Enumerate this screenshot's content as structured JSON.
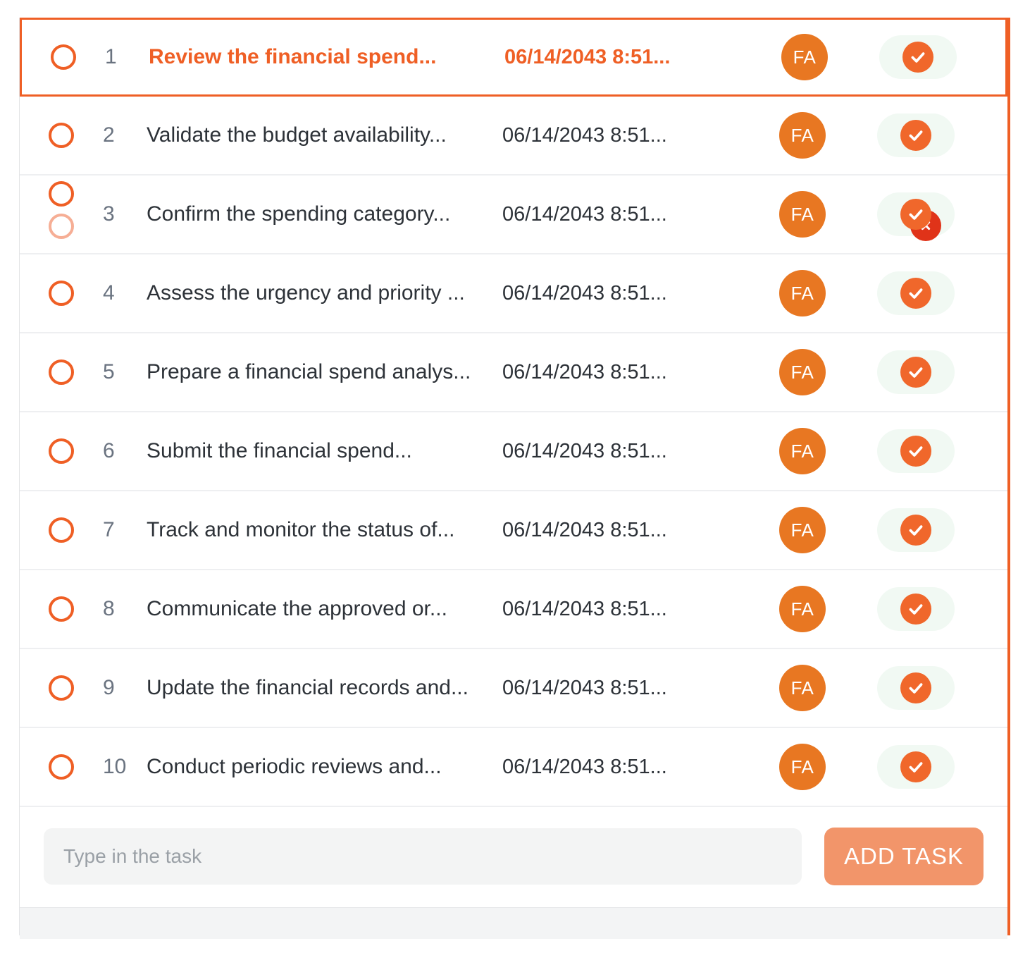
{
  "panel": {
    "accent_color": "#ef5f25",
    "selected_row_index": 1
  },
  "tasks": [
    {
      "index": "1",
      "title": "Review the financial spend...",
      "date": "06/14/2043 8:51...",
      "assignee_initials": "FA",
      "status": "done",
      "selected": true,
      "dragging": false
    },
    {
      "index": "2",
      "title": "Validate the budget availability...",
      "date": "06/14/2043 8:51...",
      "assignee_initials": "FA",
      "status": "done",
      "selected": false,
      "dragging": false
    },
    {
      "index": "3",
      "title": "Confirm the spending category...",
      "date": "06/14/2043 8:51...",
      "assignee_initials": "FA",
      "status": "done-rejected",
      "selected": false,
      "dragging": true
    },
    {
      "index": "4",
      "title": "Assess the urgency and priority ...",
      "date": "06/14/2043 8:51...",
      "assignee_initials": "FA",
      "status": "done",
      "selected": false,
      "dragging": false
    },
    {
      "index": "5",
      "title": "Prepare a financial spend analys...",
      "date": "06/14/2043 8:51...",
      "assignee_initials": "FA",
      "status": "done",
      "selected": false,
      "dragging": false
    },
    {
      "index": "6",
      "title": "Submit the financial spend...",
      "date": "06/14/2043 8:51...",
      "assignee_initials": "FA",
      "status": "done",
      "selected": false,
      "dragging": false
    },
    {
      "index": "7",
      "title": "Track and monitor the status of...",
      "date": "06/14/2043 8:51...",
      "assignee_initials": "FA",
      "status": "done",
      "selected": false,
      "dragging": false
    },
    {
      "index": "8",
      "title": "Communicate the approved or...",
      "date": "06/14/2043 8:51...",
      "assignee_initials": "FA",
      "status": "done",
      "selected": false,
      "dragging": false
    },
    {
      "index": "9",
      "title": "Update the financial records and...",
      "date": "06/14/2043 8:51...",
      "assignee_initials": "FA",
      "status": "done",
      "selected": false,
      "dragging": false
    },
    {
      "index": "10",
      "title": "Conduct periodic reviews and...",
      "date": "06/14/2043 8:51...",
      "assignee_initials": "FA",
      "status": "done",
      "selected": false,
      "dragging": false
    }
  ],
  "composer": {
    "input_value": "",
    "input_placeholder": "Type in the task",
    "add_button_label": "ADD TASK"
  },
  "icons": {
    "checkbox": "circle-outline-icon",
    "status_done": "check-circle-icon",
    "status_rejected": "x-circle-icon"
  }
}
